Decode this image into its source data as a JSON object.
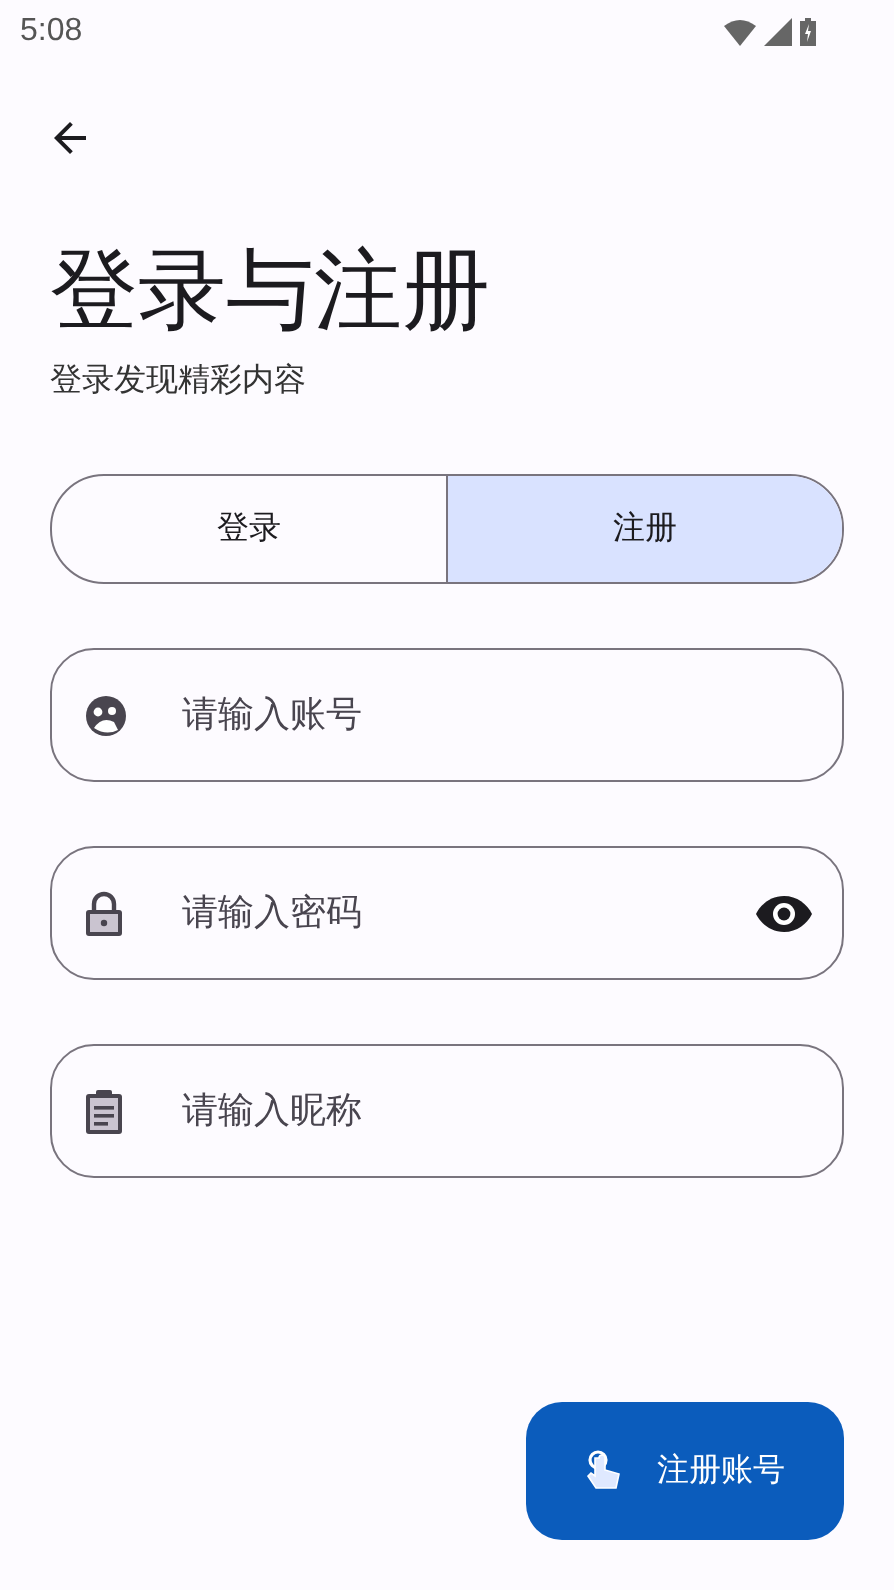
{
  "status_bar": {
    "time": "5:08"
  },
  "header": {
    "title": "登录与注册",
    "subtitle": "登录发现精彩内容"
  },
  "tabs": [
    {
      "label": "登录",
      "selected": false
    },
    {
      "label": "注册",
      "selected": true
    }
  ],
  "fields": [
    {
      "kind": "account",
      "placeholder": "请输入账号"
    },
    {
      "kind": "password",
      "placeholder": "请输入密码"
    },
    {
      "kind": "nickname",
      "placeholder": "请输入昵称"
    }
  ],
  "fab": {
    "label": "注册账号"
  }
}
